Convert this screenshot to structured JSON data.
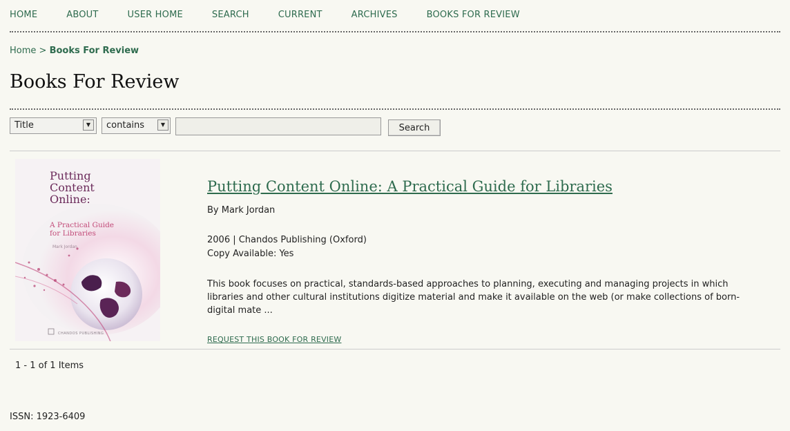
{
  "nav": {
    "items": [
      {
        "label": "HOME"
      },
      {
        "label": "ABOUT"
      },
      {
        "label": "USER HOME"
      },
      {
        "label": "SEARCH"
      },
      {
        "label": "CURRENT"
      },
      {
        "label": "ARCHIVES"
      },
      {
        "label": "BOOKS FOR REVIEW"
      }
    ]
  },
  "breadcrumb": {
    "home": "Home",
    "separator": ">",
    "current": "Books For Review"
  },
  "page_title": "Books For Review",
  "search": {
    "field_select": "Title",
    "operator_select": "contains",
    "query_value": "",
    "button_label": "Search"
  },
  "book": {
    "cover": {
      "title_lines": [
        "Putting",
        "Content",
        "Online:"
      ],
      "subtitle_lines": [
        "A Practical Guide",
        "for Libraries"
      ],
      "author": "Mark Jordan",
      "publisher": "CHANDOS PUBLISHING"
    },
    "title": "Putting Content Online: A Practical Guide for Libraries",
    "author": "By Mark Jordan",
    "publication": "2006 | Chandos Publishing (Oxford)",
    "copy_available": "Copy Available: Yes",
    "description": "This book focuses on practical, standards-based approaches to planning, executing and managing projects in which libraries and other cultural institutions digitize material and make it available on the web (or make collections of born-digital mate ...",
    "request_link": "REQUEST THIS BOOK FOR REVIEW"
  },
  "pagination": {
    "summary": "1 - 1 of 1 Items"
  },
  "footer": {
    "issn": "ISSN: 1923-6409"
  },
  "colors": {
    "background": "#f8f8f2",
    "link_green": "#2e6b4e",
    "cover_title_purple": "#6b2a5a",
    "cover_subtitle_pink": "#c24a78"
  }
}
